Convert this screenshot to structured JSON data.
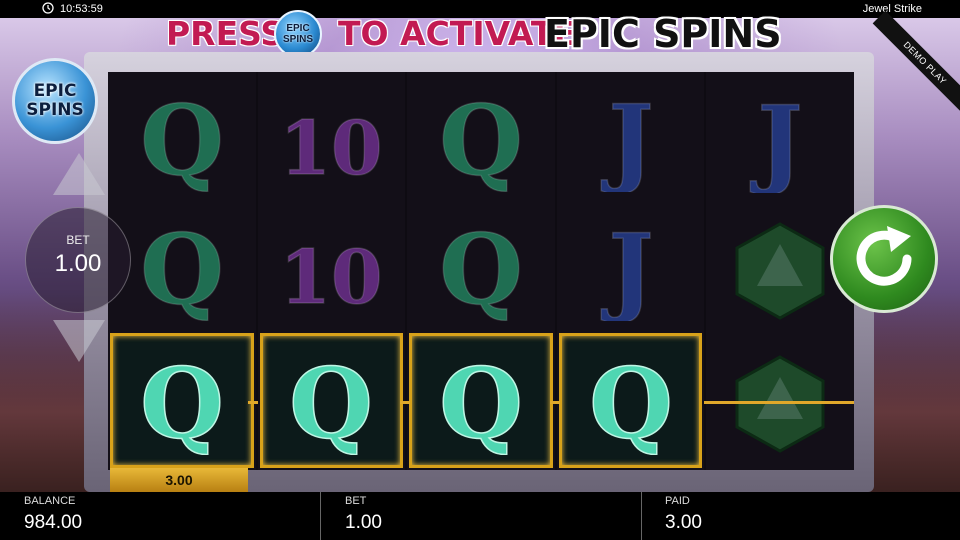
{
  "status_bar": {
    "time": "10:53:59",
    "game_title": "Jewel Strike"
  },
  "banner": {
    "press": "PRESS",
    "badge_top": "EPIC",
    "badge_bottom": "SPINS",
    "activate": "TO ACTIVATE",
    "epic_spins": "EPIC SPINS"
  },
  "demo_label": "DEMO PLAY",
  "epic_spins_button": {
    "top": "EPIC",
    "bottom": "SPINS"
  },
  "bet_control": {
    "label": "BET",
    "value": "1.00"
  },
  "reels": [
    [
      "Q",
      "Q",
      "Q"
    ],
    [
      "10",
      "10",
      "Q"
    ],
    [
      "Q",
      "Q",
      "Q"
    ],
    [
      "J",
      "J",
      "Q"
    ],
    [
      "J",
      "gem",
      "gem"
    ]
  ],
  "win_amount": "3.00",
  "bottom_bar": {
    "balance_label": "BALANCE",
    "balance_value": "984.00",
    "bet_label": "BET",
    "bet_value": "1.00",
    "paid_label": "PAID",
    "paid_value": "3.00"
  },
  "colors": {
    "q_symbol": "#1f6e52",
    "q_symbol_win": "#4fd6b2",
    "ten_symbol": "#5e2a7a",
    "j_symbol": "#22357a",
    "gem": "#1e4a2a",
    "win_frame": "#d8a21a",
    "spin_button": "#2f8a1f",
    "epic_spins_badge": "#3a93d6"
  }
}
